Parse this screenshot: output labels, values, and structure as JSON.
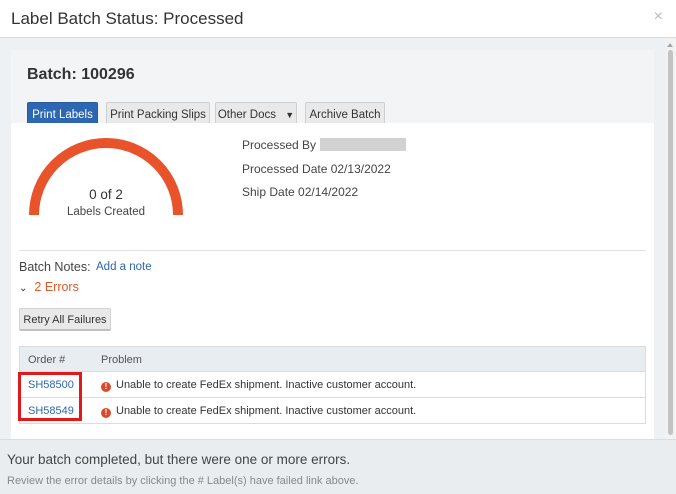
{
  "modal": {
    "title": "Label Batch Status: Processed",
    "close_glyph": "×"
  },
  "batch": {
    "title": "Batch: 100296"
  },
  "toolbar": {
    "print_labels": "Print Labels",
    "print_packing_slips": "Print Packing Slips",
    "other_docs": "Other Docs",
    "other_docs_caret": "▼",
    "archive_batch": "Archive Batch"
  },
  "gauge": {
    "count": "0 of 2",
    "label": "Labels Created",
    "created": 0,
    "total": 2,
    "color": "#e9532c"
  },
  "meta": {
    "processed_by_label": "Processed By",
    "processed_date": "Processed Date 02/13/2022",
    "ship_date": "Ship Date 02/14/2022"
  },
  "notes": {
    "label": "Batch Notes:",
    "add_link": "Add a note"
  },
  "errors": {
    "toggle_label": "2 Errors",
    "chevron": "⌄"
  },
  "retry": {
    "label": "Retry All Failures"
  },
  "table": {
    "headers": {
      "order": "Order #",
      "problem": "Problem"
    },
    "rows": [
      {
        "order": "SH58500",
        "problem": "Unable to create FedEx shipment. Inactive customer account."
      },
      {
        "order": "SH58549",
        "problem": "Unable to create FedEx shipment. Inactive customer account."
      }
    ],
    "warning_glyph": "!"
  },
  "footer": {
    "message": "Your batch completed, but there were one or more errors.",
    "hint": "Review the error details by clicking the # Label(s) have failed link above."
  },
  "colors": {
    "primary": "#2d66b1",
    "error": "#e05a2b",
    "highlight": "#e01a1a"
  }
}
